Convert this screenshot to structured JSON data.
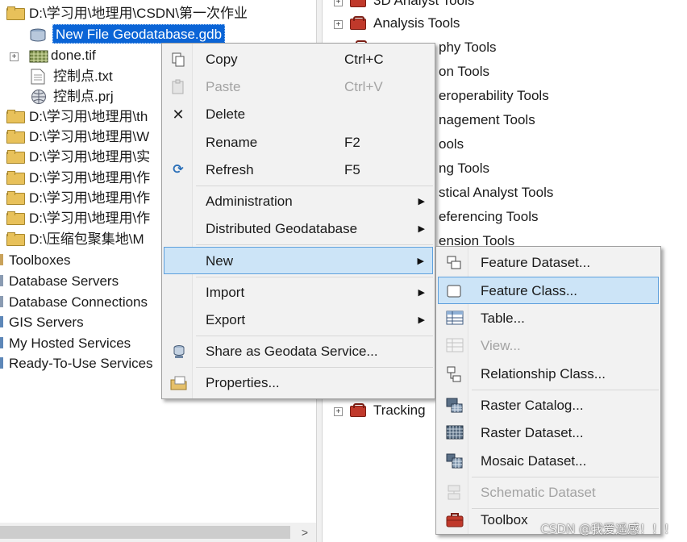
{
  "left_tree": {
    "rows": [
      {
        "label": "D:\\学习用\\地理用\\CSDN\\第一次作业",
        "type": "folder"
      },
      {
        "label": "New File Geodatabase.gdb",
        "type": "gdb",
        "selected": true
      },
      {
        "label": "done.tif",
        "type": "raster",
        "expand": "+"
      },
      {
        "label": "控制点.txt",
        "type": "text"
      },
      {
        "label": "控制点.prj",
        "type": "prj"
      },
      {
        "label": "D:\\学习用\\地理用\\th",
        "type": "folder"
      },
      {
        "label": "D:\\学习用\\地理用\\W",
        "type": "folder"
      },
      {
        "label": "D:\\学习用\\地理用\\实",
        "type": "folder"
      },
      {
        "label": "D:\\学习用\\地理用\\作",
        "type": "folder"
      },
      {
        "label": "D:\\学习用\\地理用\\作",
        "type": "folder"
      },
      {
        "label": "D:\\学习用\\地理用\\作",
        "type": "folder"
      },
      {
        "label": "D:\\压缩包聚集地\\M",
        "type": "folder"
      },
      {
        "label": "Toolboxes",
        "type": "root"
      },
      {
        "label": "Database Servers",
        "type": "root"
      },
      {
        "label": "Database Connections",
        "type": "root"
      },
      {
        "label": "GIS Servers",
        "type": "root"
      },
      {
        "label": "My Hosted Services",
        "type": "root"
      },
      {
        "label": "Ready-To-Use Services",
        "type": "root"
      }
    ],
    "scroll_arrow": ">"
  },
  "right_tree": {
    "rows": [
      {
        "label": "3D Analyst Tools"
      },
      {
        "label": "Analysis Tools"
      },
      {
        "label": "Cartography Tools",
        "visible_part": "phy Tools"
      },
      {
        "label": "Conversion Tools",
        "visible_part": "on Tools"
      },
      {
        "label": "Data Interoperability Tools",
        "visible_part": "eroperability Tools"
      },
      {
        "label": "Data Management Tools",
        "visible_part": "nagement Tools"
      },
      {
        "label": "Editing Tools",
        "visible_part": "ools"
      },
      {
        "label": "Geocoding Tools",
        "visible_part": "ng Tools"
      },
      {
        "label": "Geostatistical Analyst Tools",
        "visible_part": "stical Analyst Tools"
      },
      {
        "label": "Georeferencing Tools",
        "visible_part": "eferencing Tools"
      },
      {
        "label": "Indoor Positioning / Extension Tools",
        "visible_part": "ension Tools"
      },
      {
        "label": "Tracking Analyst Tools",
        "visible_part": "Tracking"
      }
    ]
  },
  "context_menu": {
    "items": [
      {
        "label": "Copy",
        "shortcut": "Ctrl+C",
        "icon": "copy-icon"
      },
      {
        "label": "Paste",
        "shortcut": "Ctrl+V",
        "icon": "paste-icon",
        "disabled": true
      },
      {
        "label": "Delete",
        "shortcut": "",
        "icon": "delete-icon"
      },
      {
        "label": "Rename",
        "shortcut": "F2",
        "icon": ""
      },
      {
        "label": "Refresh",
        "shortcut": "F5",
        "icon": "refresh-icon"
      },
      {
        "label": "Administration",
        "submenu": true
      },
      {
        "label": "Distributed Geodatabase",
        "submenu": true
      },
      {
        "label": "New",
        "submenu": true,
        "highlighted": true
      },
      {
        "label": "Import",
        "submenu": true
      },
      {
        "label": "Export",
        "submenu": true
      },
      {
        "label": "Share as Geodata Service...",
        "icon": "geodata-service-icon"
      },
      {
        "label": "Properties...",
        "icon": "properties-icon"
      }
    ]
  },
  "new_submenu": {
    "items": [
      {
        "label": "Feature Dataset...",
        "icon": "feature-dataset-icon"
      },
      {
        "label": "Feature Class...",
        "icon": "feature-class-icon",
        "highlighted": true
      },
      {
        "label": "Table...",
        "icon": "table-icon"
      },
      {
        "label": "View...",
        "icon": "view-icon",
        "disabled": true
      },
      {
        "label": "Relationship Class...",
        "icon": "relationship-class-icon"
      },
      {
        "label": "Raster Catalog...",
        "icon": "raster-catalog-icon"
      },
      {
        "label": "Raster Dataset...",
        "icon": "raster-dataset-icon"
      },
      {
        "label": "Mosaic Dataset...",
        "icon": "mosaic-dataset-icon"
      },
      {
        "label": "Schematic Dataset",
        "icon": "schematic-dataset-icon",
        "disabled": true
      },
      {
        "label": "Toolbox",
        "icon": "toolbox-icon"
      }
    ]
  },
  "watermark": "CSDN @我爱遥感！！！",
  "colors": {
    "selection": "#0a64d6",
    "menu_highlight": "#cce4f7",
    "menu_highlight_border": "#5ea0dd",
    "folder": "#e8c15a",
    "toolbox": "#c0392b"
  }
}
